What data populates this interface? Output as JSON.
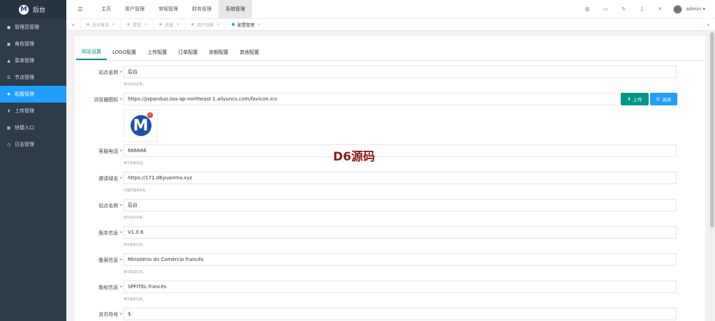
{
  "brand": {
    "logo_letter": "M",
    "title": "后台"
  },
  "sidebar": {
    "items": [
      {
        "icon": "user-icon",
        "glyph": "●",
        "label": "管理员管理"
      },
      {
        "icon": "role-icon",
        "glyph": "▣",
        "label": "角色管理"
      },
      {
        "icon": "bell-icon",
        "glyph": "▲",
        "label": "菜单管理"
      },
      {
        "icon": "list-icon",
        "glyph": "☰",
        "label": "节点管理"
      },
      {
        "icon": "gear-icon",
        "glyph": "✱",
        "label": "配置管理"
      },
      {
        "icon": "upload-icon",
        "glyph": "⬆",
        "label": "上传管理"
      },
      {
        "icon": "shortcut-icon",
        "glyph": "▦",
        "label": "快捷入口"
      },
      {
        "icon": "clock-icon",
        "glyph": "◷",
        "label": "日志管理"
      }
    ],
    "active_index": 4
  },
  "topbar": {
    "toggle_glyph": "☰",
    "nav": [
      "主页",
      "用户管理",
      "常规管理",
      "财务管理",
      "系统管理"
    ],
    "active_nav": 4,
    "right_icons": [
      {
        "name": "chart-icon",
        "glyph": "▥"
      },
      {
        "name": "card-icon",
        "glyph": "▭"
      },
      {
        "name": "refresh-icon",
        "glyph": "↻"
      },
      {
        "name": "trash-icon",
        "glyph": "▯"
      },
      {
        "name": "fullscreen-icon",
        "glyph": "✕"
      }
    ],
    "user": "admin ▾"
  },
  "tabs": {
    "items": [
      "后台首页",
      "提现",
      "充值",
      "用户列表",
      "配置管理"
    ],
    "active_index": 4,
    "left_arrow": "‹",
    "right_arrow": "›",
    "close_glyph": "×"
  },
  "form_tabs": [
    "网站设置",
    "LOGO配置",
    "上传配置",
    "订单配置",
    "余额配置",
    "其他配置"
  ],
  "fields": {
    "site_name": {
      "label": "站点名称",
      "value": "后台",
      "hint": "填写站点名称。"
    },
    "favicon": {
      "label": "浏览器图标",
      "value": "https://japanduo.oss-ap-northeast-1.aliyuncs.com/favicon.ico",
      "upload_label": "上传",
      "choose_label": "选择",
      "preview_letter": "M",
      "delete_glyph": "×"
    },
    "service_phone": {
      "label": "客服电话",
      "value": "666666",
      "hint": "填写客服电话。"
    },
    "invite_domain": {
      "label": "邀请域名",
      "value": "https://171.d6yuanma.xyz",
      "hint": "代理的邀请域名。"
    },
    "site_name_2": {
      "label": "站点名称",
      "value": "后台",
      "hint": "填写站点名称。"
    },
    "version": {
      "label": "版本信息",
      "value": "V1.0.6",
      "hint": "填写版本信息。"
    },
    "record": {
      "label": "备案信息",
      "value": "Ministério do Comércio francês",
      "hint": "填写备案信息。"
    },
    "copyright": {
      "label": "版权信息",
      "value": "SPFITEL francês",
      "hint": "填写版权信息。"
    },
    "currency": {
      "label": "货币符号",
      "value": "$"
    }
  },
  "watermark": "D6源码"
}
